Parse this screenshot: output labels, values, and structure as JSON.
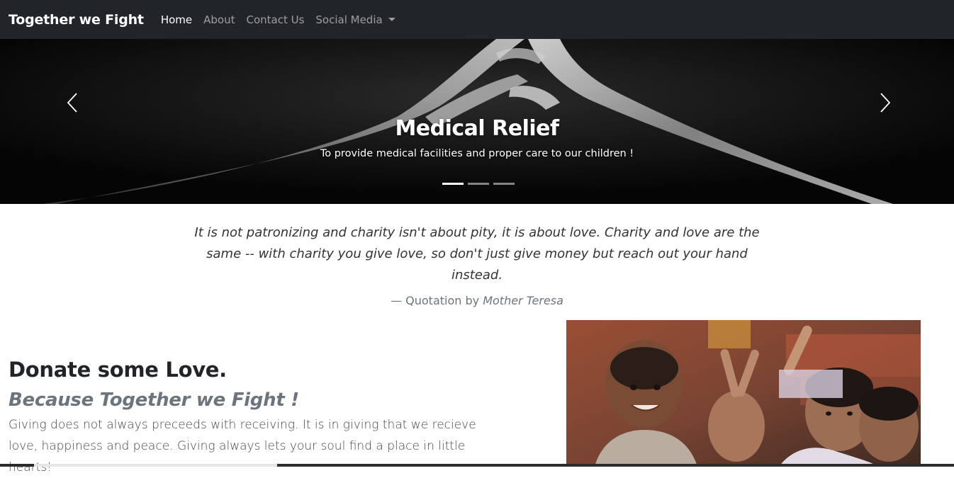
{
  "navbar": {
    "brand": "Together we Fight",
    "links": [
      {
        "label": "Home",
        "active": true
      },
      {
        "label": "About",
        "active": false
      },
      {
        "label": "Contact Us",
        "active": false
      },
      {
        "label": "Social Media",
        "active": false
      }
    ],
    "background_color": "#212529"
  },
  "carousel": {
    "title": "Medical Relief",
    "text": "To provide medical facilities and proper care to our children !",
    "prev_icon": "chevron-left-icon",
    "next_icon": "chevron-right-icon",
    "slide_count": 3,
    "active_slide": 1
  },
  "quote": {
    "text": "It is not patronizing and charity isn't about pity, it is about love. Charity and love are the same -- with charity you give love, so don't just give money but reach out your hand instead.",
    "attribution_prefix": "— Quotation by",
    "author": "Mother Teresa"
  },
  "donate": {
    "title": "Donate some Love.",
    "subtitle": "Because Together we Fight !",
    "text": "Giving does not always preceeds with receiving. It is in giving that we recieve love, happiness and peace. Giving always lets your soul find a place in little hearts!"
  },
  "colors": {
    "muted": "#6c757d",
    "dark": "#212529"
  }
}
